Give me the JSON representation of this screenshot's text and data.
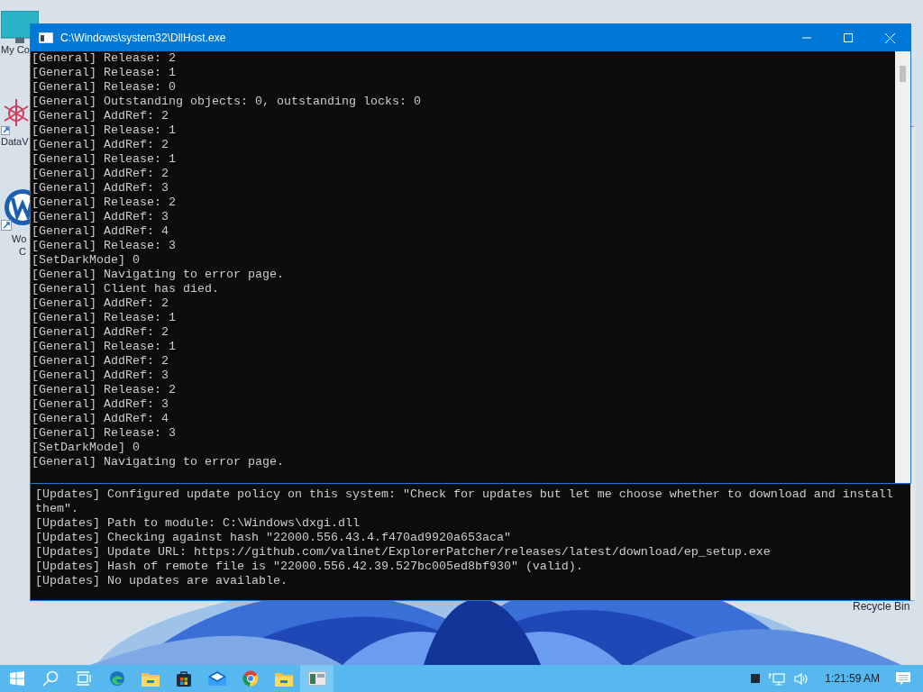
{
  "desktop_icons": [
    {
      "kind": "computer",
      "lines": [
        "My Co"
      ]
    },
    {
      "kind": "molecule",
      "lines": [
        "DataV"
      ]
    },
    {
      "kind": "word",
      "lines": [
        "Wo",
        "C"
      ]
    }
  ],
  "recycle_bin": {
    "label": "Recycle Bin"
  },
  "background_console": {
    "lines": [
      "[Updates] Configured update policy on this system: \"Check for updates but let me choose whether to download and install them\".",
      "[Updates] Path to module: C:\\Windows\\dxgi.dll",
      "[Updates] Checking against hash \"22000.556.43.4.f470ad9920a653aca\"",
      "[Updates] Update URL: https://github.com/valinet/ExplorerPatcher/releases/latest/download/ep_setup.exe",
      "[Updates] Hash of remote file is \"22000.556.42.39.527bc005ed8bf930\" (valid).",
      "[Updates] No updates are available."
    ]
  },
  "console_window": {
    "title": "C:\\Windows\\system32\\DllHost.exe",
    "lines": [
      "[General] Release: 2",
      "[General] Release: 1",
      "[General] Release: 0",
      "[General] Outstanding objects: 0, outstanding locks: 0",
      "[General] AddRef: 2",
      "[General] Release: 1",
      "[General] AddRef: 2",
      "[General] Release: 1",
      "[General] AddRef: 2",
      "[General] AddRef: 3",
      "[General] Release: 2",
      "[General] AddRef: 3",
      "[General] AddRef: 4",
      "[General] Release: 3",
      "[SetDarkMode] 0",
      "[General] Navigating to error page.",
      "[General] Client has died.",
      "[General] AddRef: 2",
      "[General] Release: 1",
      "[General] AddRef: 2",
      "[General] Release: 1",
      "[General] AddRef: 2",
      "[General] AddRef: 3",
      "[General] Release: 2",
      "[General] AddRef: 3",
      "[General] AddRef: 4",
      "[General] Release: 3",
      "[SetDarkMode] 0",
      "[General] Navigating to error page."
    ]
  },
  "taskbar": {
    "apps": [
      {
        "kind": "start",
        "selected": false
      },
      {
        "kind": "search",
        "selected": false
      },
      {
        "kind": "taskview",
        "selected": false
      },
      {
        "kind": "edge",
        "selected": false
      },
      {
        "kind": "folder",
        "selected": false
      },
      {
        "kind": "store",
        "selected": false
      },
      {
        "kind": "mail",
        "selected": false
      },
      {
        "kind": "chrome",
        "selected": false
      },
      {
        "kind": "folder",
        "selected": false
      },
      {
        "kind": "console",
        "selected": true
      }
    ],
    "clock": "1:21:59 AM"
  }
}
